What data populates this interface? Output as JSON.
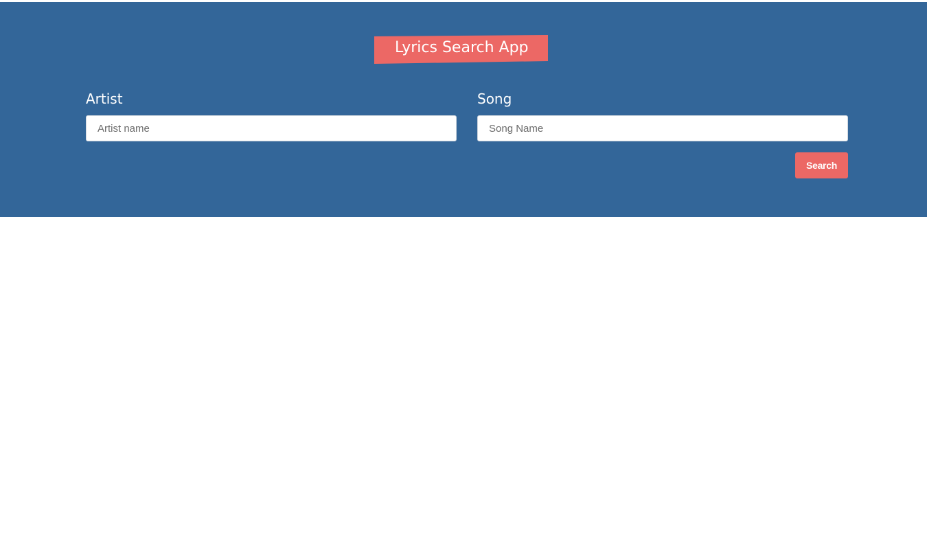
{
  "app": {
    "title": "Lyrics Search App"
  },
  "form": {
    "artist_label": "Artist",
    "artist_placeholder": "Artist name",
    "artist_value": "",
    "song_label": "Song",
    "song_placeholder": "Song Name",
    "song_value": "",
    "search_label": "Search"
  },
  "colors": {
    "header_background": "#336699",
    "accent": "#ec6865",
    "page_background": "#ffffff"
  }
}
